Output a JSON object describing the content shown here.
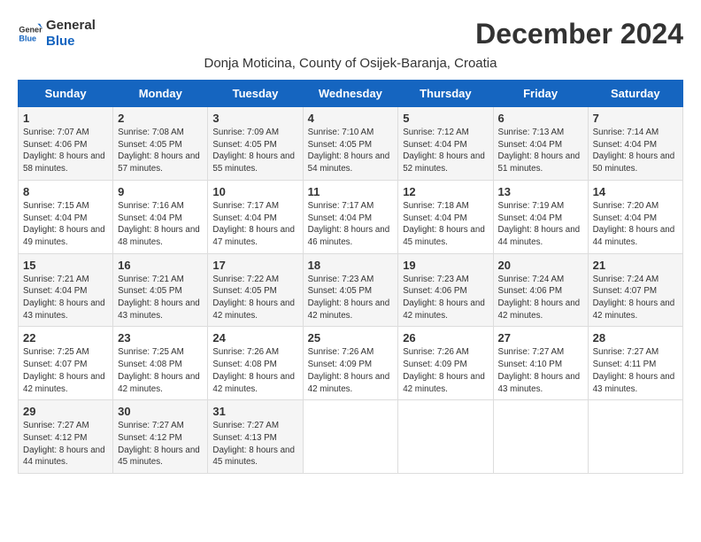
{
  "header": {
    "logo_general": "General",
    "logo_blue": "Blue",
    "month_year": "December 2024",
    "location": "Donja Moticina, County of Osijek-Baranja, Croatia"
  },
  "weekdays": [
    "Sunday",
    "Monday",
    "Tuesday",
    "Wednesday",
    "Thursday",
    "Friday",
    "Saturday"
  ],
  "weeks": [
    [
      {
        "day": "1",
        "sunrise": "Sunrise: 7:07 AM",
        "sunset": "Sunset: 4:06 PM",
        "daylight": "Daylight: 8 hours and 58 minutes."
      },
      {
        "day": "2",
        "sunrise": "Sunrise: 7:08 AM",
        "sunset": "Sunset: 4:05 PM",
        "daylight": "Daylight: 8 hours and 57 minutes."
      },
      {
        "day": "3",
        "sunrise": "Sunrise: 7:09 AM",
        "sunset": "Sunset: 4:05 PM",
        "daylight": "Daylight: 8 hours and 55 minutes."
      },
      {
        "day": "4",
        "sunrise": "Sunrise: 7:10 AM",
        "sunset": "Sunset: 4:05 PM",
        "daylight": "Daylight: 8 hours and 54 minutes."
      },
      {
        "day": "5",
        "sunrise": "Sunrise: 7:12 AM",
        "sunset": "Sunset: 4:04 PM",
        "daylight": "Daylight: 8 hours and 52 minutes."
      },
      {
        "day": "6",
        "sunrise": "Sunrise: 7:13 AM",
        "sunset": "Sunset: 4:04 PM",
        "daylight": "Daylight: 8 hours and 51 minutes."
      },
      {
        "day": "7",
        "sunrise": "Sunrise: 7:14 AM",
        "sunset": "Sunset: 4:04 PM",
        "daylight": "Daylight: 8 hours and 50 minutes."
      }
    ],
    [
      {
        "day": "8",
        "sunrise": "Sunrise: 7:15 AM",
        "sunset": "Sunset: 4:04 PM",
        "daylight": "Daylight: 8 hours and 49 minutes."
      },
      {
        "day": "9",
        "sunrise": "Sunrise: 7:16 AM",
        "sunset": "Sunset: 4:04 PM",
        "daylight": "Daylight: 8 hours and 48 minutes."
      },
      {
        "day": "10",
        "sunrise": "Sunrise: 7:17 AM",
        "sunset": "Sunset: 4:04 PM",
        "daylight": "Daylight: 8 hours and 47 minutes."
      },
      {
        "day": "11",
        "sunrise": "Sunrise: 7:17 AM",
        "sunset": "Sunset: 4:04 PM",
        "daylight": "Daylight: 8 hours and 46 minutes."
      },
      {
        "day": "12",
        "sunrise": "Sunrise: 7:18 AM",
        "sunset": "Sunset: 4:04 PM",
        "daylight": "Daylight: 8 hours and 45 minutes."
      },
      {
        "day": "13",
        "sunrise": "Sunrise: 7:19 AM",
        "sunset": "Sunset: 4:04 PM",
        "daylight": "Daylight: 8 hours and 44 minutes."
      },
      {
        "day": "14",
        "sunrise": "Sunrise: 7:20 AM",
        "sunset": "Sunset: 4:04 PM",
        "daylight": "Daylight: 8 hours and 44 minutes."
      }
    ],
    [
      {
        "day": "15",
        "sunrise": "Sunrise: 7:21 AM",
        "sunset": "Sunset: 4:04 PM",
        "daylight": "Daylight: 8 hours and 43 minutes."
      },
      {
        "day": "16",
        "sunrise": "Sunrise: 7:21 AM",
        "sunset": "Sunset: 4:05 PM",
        "daylight": "Daylight: 8 hours and 43 minutes."
      },
      {
        "day": "17",
        "sunrise": "Sunrise: 7:22 AM",
        "sunset": "Sunset: 4:05 PM",
        "daylight": "Daylight: 8 hours and 42 minutes."
      },
      {
        "day": "18",
        "sunrise": "Sunrise: 7:23 AM",
        "sunset": "Sunset: 4:05 PM",
        "daylight": "Daylight: 8 hours and 42 minutes."
      },
      {
        "day": "19",
        "sunrise": "Sunrise: 7:23 AM",
        "sunset": "Sunset: 4:06 PM",
        "daylight": "Daylight: 8 hours and 42 minutes."
      },
      {
        "day": "20",
        "sunrise": "Sunrise: 7:24 AM",
        "sunset": "Sunset: 4:06 PM",
        "daylight": "Daylight: 8 hours and 42 minutes."
      },
      {
        "day": "21",
        "sunrise": "Sunrise: 7:24 AM",
        "sunset": "Sunset: 4:07 PM",
        "daylight": "Daylight: 8 hours and 42 minutes."
      }
    ],
    [
      {
        "day": "22",
        "sunrise": "Sunrise: 7:25 AM",
        "sunset": "Sunset: 4:07 PM",
        "daylight": "Daylight: 8 hours and 42 minutes."
      },
      {
        "day": "23",
        "sunrise": "Sunrise: 7:25 AM",
        "sunset": "Sunset: 4:08 PM",
        "daylight": "Daylight: 8 hours and 42 minutes."
      },
      {
        "day": "24",
        "sunrise": "Sunrise: 7:26 AM",
        "sunset": "Sunset: 4:08 PM",
        "daylight": "Daylight: 8 hours and 42 minutes."
      },
      {
        "day": "25",
        "sunrise": "Sunrise: 7:26 AM",
        "sunset": "Sunset: 4:09 PM",
        "daylight": "Daylight: 8 hours and 42 minutes."
      },
      {
        "day": "26",
        "sunrise": "Sunrise: 7:26 AM",
        "sunset": "Sunset: 4:09 PM",
        "daylight": "Daylight: 8 hours and 42 minutes."
      },
      {
        "day": "27",
        "sunrise": "Sunrise: 7:27 AM",
        "sunset": "Sunset: 4:10 PM",
        "daylight": "Daylight: 8 hours and 43 minutes."
      },
      {
        "day": "28",
        "sunrise": "Sunrise: 7:27 AM",
        "sunset": "Sunset: 4:11 PM",
        "daylight": "Daylight: 8 hours and 43 minutes."
      }
    ],
    [
      {
        "day": "29",
        "sunrise": "Sunrise: 7:27 AM",
        "sunset": "Sunset: 4:12 PM",
        "daylight": "Daylight: 8 hours and 44 minutes."
      },
      {
        "day": "30",
        "sunrise": "Sunrise: 7:27 AM",
        "sunset": "Sunset: 4:12 PM",
        "daylight": "Daylight: 8 hours and 45 minutes."
      },
      {
        "day": "31",
        "sunrise": "Sunrise: 7:27 AM",
        "sunset": "Sunset: 4:13 PM",
        "daylight": "Daylight: 8 hours and 45 minutes."
      },
      null,
      null,
      null,
      null
    ]
  ]
}
